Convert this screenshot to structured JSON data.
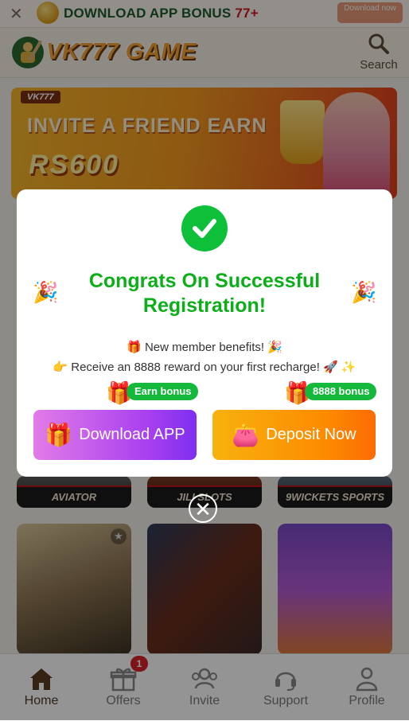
{
  "topbar": {
    "title": "DOWNLOAD APP BONUS",
    "amount": "77+",
    "download_button": "Download now"
  },
  "header": {
    "logo_text": "VK777 GAME",
    "search_label": "Search"
  },
  "banner": {
    "tag": "VK777",
    "line1": "INVITE A FRIEND EARN",
    "line2": "RS600"
  },
  "games": [
    {
      "label": "AVIATOR"
    },
    {
      "label": "JILI SLOTS"
    },
    {
      "label": "9WICKETS SPORTS"
    }
  ],
  "modal": {
    "title": "Congrats On Successful Registration!",
    "benefit1_prefix": "🎁",
    "benefit1": "New member benefits!",
    "benefit1_suffix": "🎉",
    "benefit2_prefix": "👉",
    "benefit2": "Receive an 8888 reward on your first recharge!",
    "benefit2_suffix": "🚀 ✨",
    "download_pill": "Earn bonus",
    "deposit_pill": "8888 bonus",
    "download_button": "Download APP",
    "deposit_button": "Deposit Now"
  },
  "nav": {
    "items": [
      {
        "label": "Home",
        "icon": "home-icon"
      },
      {
        "label": "Offers",
        "icon": "gift-icon"
      },
      {
        "label": "Invite",
        "icon": "users-icon"
      },
      {
        "label": "Support",
        "icon": "headset-icon"
      },
      {
        "label": "Profile",
        "icon": "person-icon"
      }
    ],
    "offers_badge": "1"
  },
  "colors": {
    "accent_green": "#0cae19",
    "brand_orange": "#f6a23a",
    "badge_red": "#d8232a"
  }
}
